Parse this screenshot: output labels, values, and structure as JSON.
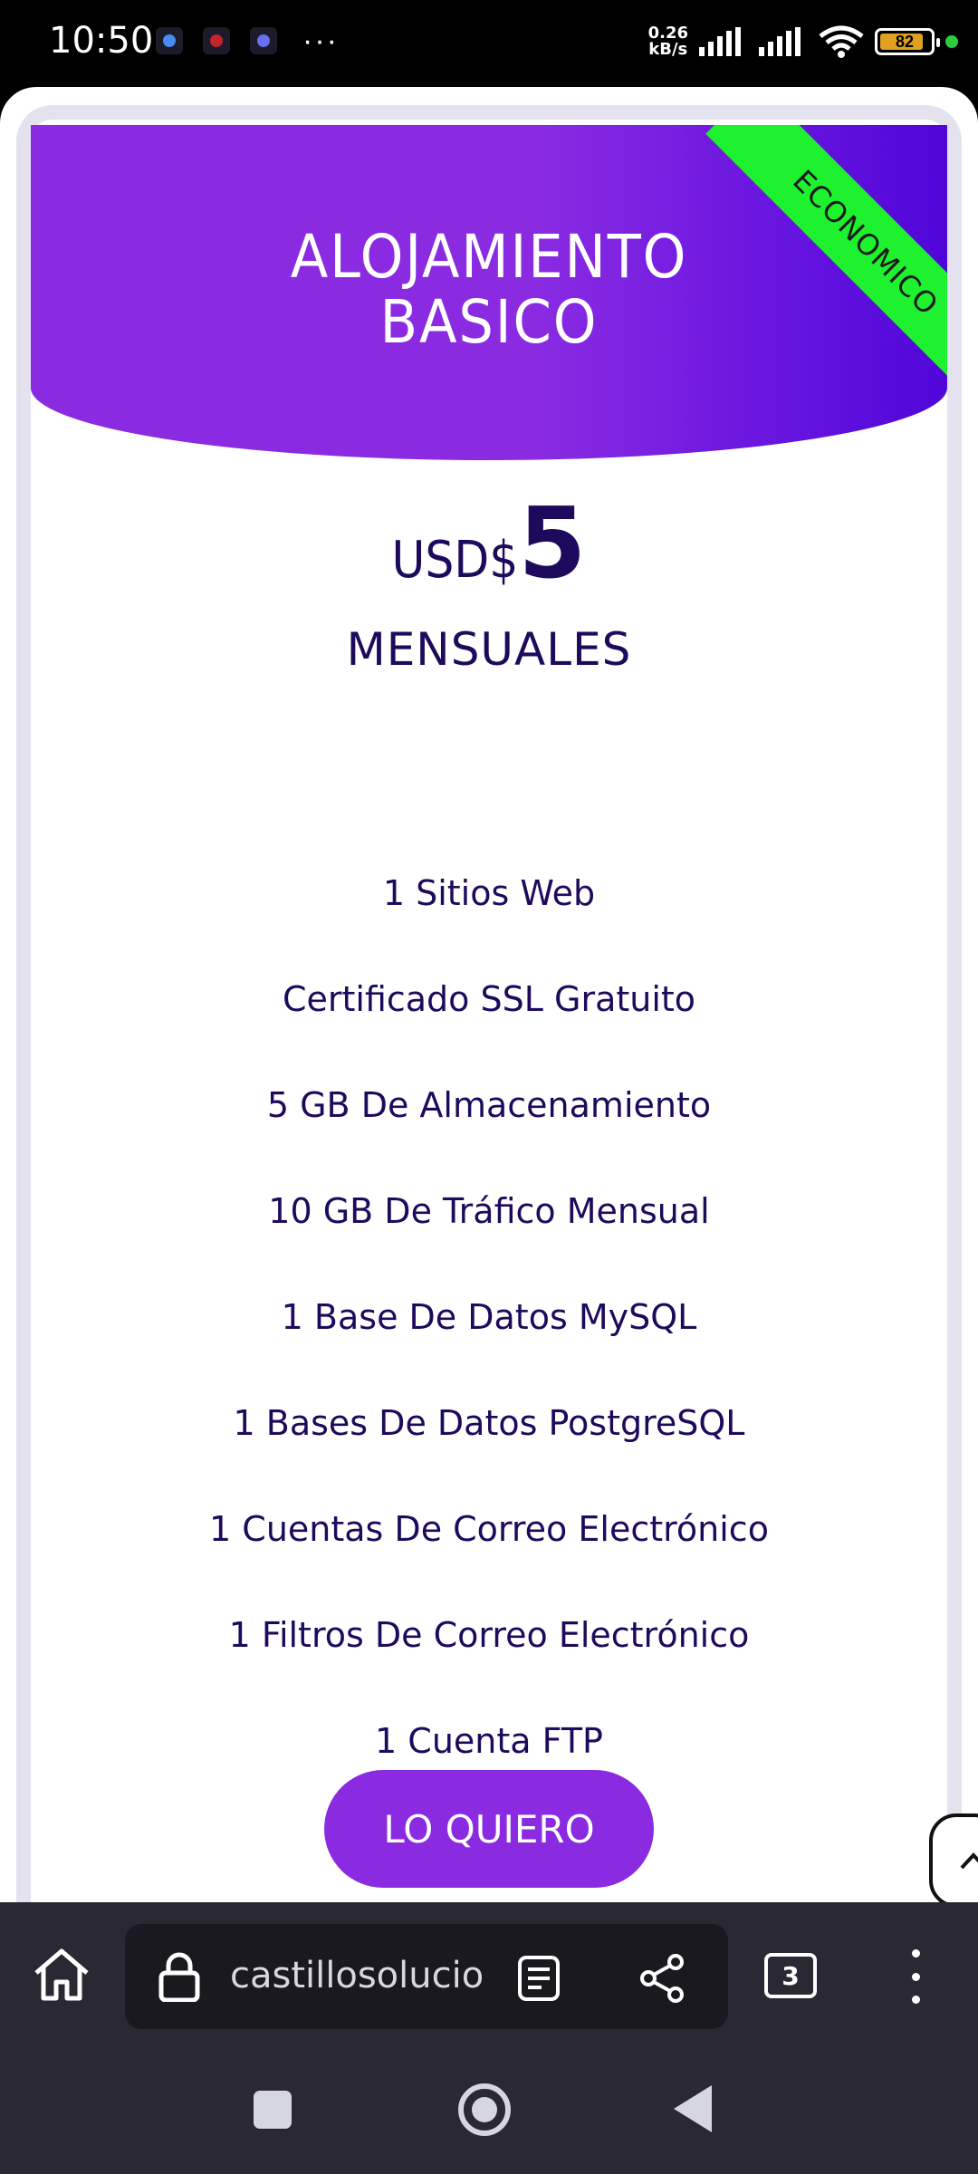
{
  "status_bar": {
    "time": "10:50",
    "network_speed_value": "0.26",
    "network_speed_unit": "kB/s",
    "battery_level": "82",
    "notification_icons": [
      "chrome-app-icon",
      "red-app-icon",
      "blue-app-icon"
    ],
    "more_indicator": "···"
  },
  "plan": {
    "title_line1": "ALOJAMIENTO",
    "title_line2": "BASICO",
    "ribbon": "ECONOMICO",
    "currency": "USD$",
    "amount": "5",
    "period": "MENSUALES",
    "features": [
      "1 Sitios Web",
      "Certificado SSL Gratuito",
      "5 GB De Almacenamiento",
      "10 GB De Tráfico Mensual",
      "1 Base De Datos MySQL",
      "1 Bases De Datos PostgreSQL",
      "1 Cuentas De Correo Electrónico",
      "1 Filtros De Correo Electrónico",
      "1 Cuenta FTP"
    ],
    "cta_label": "LO QUIERO"
  },
  "browser": {
    "url": "castillosolucio",
    "tab_count": "3"
  },
  "colors": {
    "brand_purple": "#8a2be2",
    "ribbon_green": "#1ef12e",
    "text_dark": "#1e0a5c"
  }
}
